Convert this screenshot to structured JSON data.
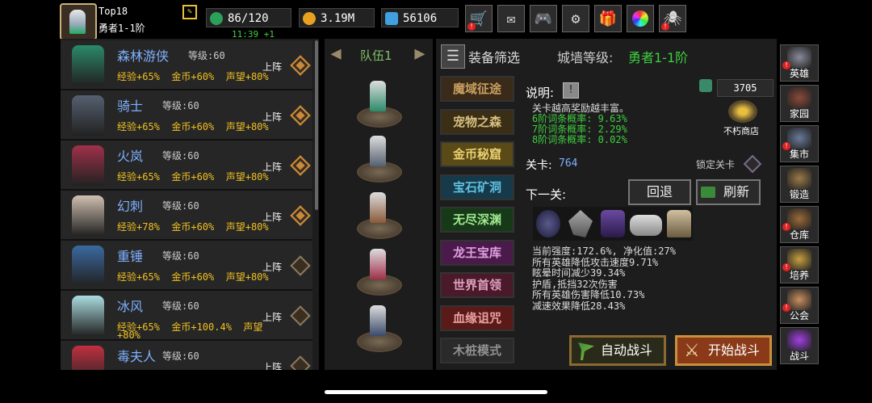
{
  "player": {
    "rank": "Top18",
    "title": "勇者1-1阶"
  },
  "resources": {
    "stamina": "86/120",
    "stamina_timer": "11:39 +1",
    "gold": "3.19M",
    "gems": "56106"
  },
  "top_buttons": [
    "cart-icon",
    "mail-icon",
    "gamepad-icon",
    "gear-icon",
    "gift-icon",
    "wheel-icon",
    "spider-icon"
  ],
  "heroes": [
    {
      "name": "森林游侠",
      "level": "等级:60",
      "exp": "经验+65%",
      "gold": "金币+60%",
      "fame": "声望+80%",
      "action": "上阵",
      "selected": true,
      "color": "#2a8a6a"
    },
    {
      "name": "骑士",
      "level": "等级:60",
      "exp": "经验+65%",
      "gold": "金币+60%",
      "fame": "声望+80%",
      "action": "上阵",
      "selected": true,
      "color": "#556070"
    },
    {
      "name": "火岚",
      "level": "等级:60",
      "exp": "经验+65%",
      "gold": "金币+60%",
      "fame": "声望+80%",
      "action": "上阵",
      "selected": true,
      "color": "#a0304a"
    },
    {
      "name": "幻刺",
      "level": "等级:60",
      "exp": "经验+78%",
      "gold": "金币+60%",
      "fame": "声望+80%",
      "action": "上阵",
      "selected": true,
      "color": "#d0c0b0"
    },
    {
      "name": "重锤",
      "level": "等级:60",
      "exp": "经验+65%",
      "gold": "金币+60%",
      "fame": "声望+80%",
      "action": "上阵",
      "selected": false,
      "color": "#3a6aa0"
    },
    {
      "name": "冰风",
      "level": "等级:60",
      "exp": "经验+65%",
      "gold": "金币+100.4%",
      "fame": "声望",
      "fame2": "+80%",
      "action": "上阵",
      "selected": false,
      "color": "#aadde0"
    },
    {
      "name": "毒夫人",
      "level": "等级:60",
      "exp": "",
      "gold": "",
      "fame": "",
      "action": "上阵",
      "selected": false,
      "color": "#c03040"
    }
  ],
  "team": {
    "label": "队伍1"
  },
  "filter": {
    "label": "装备筛选"
  },
  "wall": {
    "label": "城墙等级:",
    "value": "勇者1-1阶"
  },
  "zones": [
    {
      "name": "魔域征途",
      "color": "#c8a060",
      "bg": "#3a2a1a"
    },
    {
      "name": "宠物之森",
      "color": "#d8c080",
      "bg": "#3a2e16"
    },
    {
      "name": "金币秘窟",
      "color": "#e8d070",
      "bg": "#5a4a18"
    },
    {
      "name": "宝石矿洞",
      "color": "#60c0e0",
      "bg": "#163a4a"
    },
    {
      "name": "无尽深渊",
      "color": "#a0e890",
      "bg": "#163a18"
    },
    {
      "name": "龙王宝库",
      "color": "#e0a0e0",
      "bg": "#4a1a4a"
    },
    {
      "name": "世界首领",
      "color": "#e0a0c0",
      "bg": "#4a1a2a"
    },
    {
      "name": "血缘诅咒",
      "color": "#e8a0a0",
      "bg": "#5a1a18"
    },
    {
      "name": "木桩模式",
      "color": "#909090",
      "bg": "#2a2a2a"
    }
  ],
  "info": {
    "desc_label": "说明:",
    "desc_lines": [
      "关卡越高奖励越丰富。",
      "6阶词条概率: 9.63%",
      "7阶词条概率: 2.29%",
      "8阶词条概率: 0.02%"
    ],
    "currency": "3705",
    "shop_label": "不朽商店",
    "stage_label": "关卡:",
    "stage_value": "764",
    "lock_label": "锁定关卡",
    "next_label": "下一关:",
    "back_label": "回退",
    "refresh_label": "刷新",
    "effects": [
      "当前强度:172.6%, 净化值:27%",
      "所有英雄降低攻击速度9.71%",
      "眩晕时间减少39.34%",
      "护盾,抵挡32次伤害",
      "所有英雄伤害降低10.73%",
      "减速效果降低28.43%"
    ],
    "auto_label": "自动战斗",
    "start_label": "开始战斗"
  },
  "side_menu": [
    {
      "label": "英雄",
      "icon": "helmet-icon",
      "color": "#8a8a9a",
      "alert": true
    },
    {
      "label": "家园",
      "icon": "castle-icon",
      "color": "#8a4a3a",
      "alert": false
    },
    {
      "label": "集市",
      "icon": "shop-icon",
      "color": "#6a7a9a",
      "alert": true
    },
    {
      "label": "锻造",
      "icon": "anvil-icon",
      "color": "#9a7a4a",
      "alert": false
    },
    {
      "label": "仓库",
      "icon": "chest-icon",
      "color": "#9a6a3a",
      "alert": true
    },
    {
      "label": "培养",
      "icon": "crest-icon",
      "color": "#c8a040",
      "alert": true
    },
    {
      "label": "公会",
      "icon": "guild-icon",
      "color": "#c89060",
      "alert": true
    },
    {
      "label": "战斗",
      "icon": "portal-icon",
      "color": "#a040e0",
      "alert": false
    }
  ]
}
